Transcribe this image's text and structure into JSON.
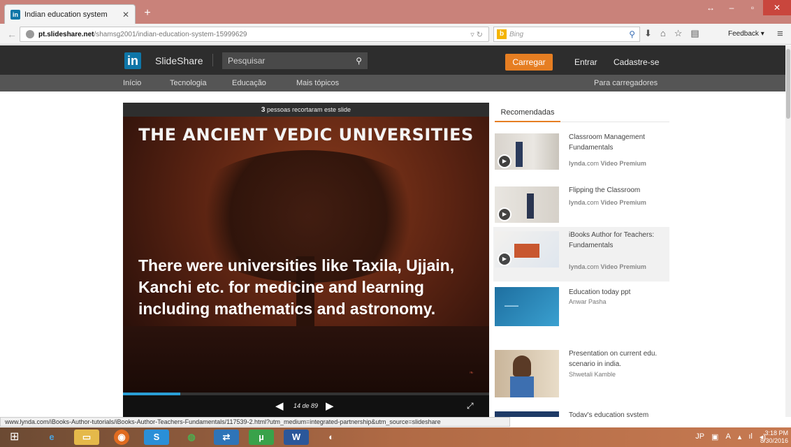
{
  "browser": {
    "tab_title": "Indian education system",
    "tab_favicon": "in",
    "url_host": "pt.slideshare.net",
    "url_path": "/shamsg2001/indian-education-system-15999629",
    "search_placeholder": "Bing",
    "feedback_label": "Feedback",
    "status_url": "www.lynda.com/iBooks-Author-tutorials/iBooks-Author-Teachers-Fundamentals/117539-2.html?utm_medium=integrated-partnership&utm_source=slideshare"
  },
  "site": {
    "logo": "in",
    "brand": "SlideShare",
    "search_placeholder": "Pesquisar",
    "upload_label": "Carregar",
    "login_label": "Entrar",
    "signup_label": "Cadastre-se",
    "nav": [
      "Início",
      "Tecnologia",
      "Educação",
      "Mais tópicos"
    ],
    "uploaders_link": "Para carregadores"
  },
  "slide": {
    "clip_count": "3",
    "clip_text": "pessoas recortaram este slide",
    "title": "THE ANCIENT VEDIC UNIVERSITIES",
    "body": "There were universities like Taxila, Ujjain, Kanchi etc. for medicine and learning including mathematics and astronomy.",
    "page_label": "14 de 89",
    "current_page": 14,
    "total_pages": 89
  },
  "recommendations": {
    "tab_label": "Recomendadas",
    "items": [
      {
        "title": "Classroom Management Fundamentals",
        "source_site": "lynda",
        "source_rest": ".com",
        "source_tag": "Video Premium",
        "author": ""
      },
      {
        "title": "Flipping the Classroom",
        "source_site": "lynda",
        "source_rest": ".com",
        "source_tag": "Video Premium",
        "author": ""
      },
      {
        "title": "iBooks Author for Teachers: Fundamentals",
        "source_site": "lynda",
        "source_rest": ".com",
        "source_tag": "Video Premium",
        "author": ""
      },
      {
        "title": "Education today ppt",
        "author": "Anwar Pasha"
      },
      {
        "title": "Presentation on current edu. scenario in india.",
        "author": "Shwetali Kamble"
      },
      {
        "title": "Today's education system",
        "author": ""
      }
    ]
  },
  "taskbar": {
    "time": "3:18 PM",
    "date": "8/30/2016"
  },
  "colors": {
    "accent_orange": "#e67e22",
    "linkedin_blue": "#0e76a8",
    "header_dark": "#2d2d2d",
    "titlebar": "#c9827a"
  }
}
